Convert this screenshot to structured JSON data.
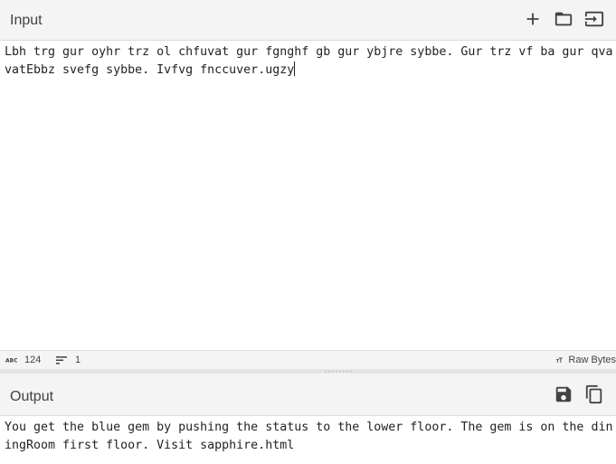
{
  "input": {
    "title": "Input",
    "text": "Lbh trg gur oyhr trz ol chfuvat gur fgnghf gb gur ybjre sybbe. Gur trz vf ba gur qvavatEbbz svefg sybbe. Ivfvg fnccuver.ugzy",
    "buttons": {
      "add_icon": "plus-icon",
      "open_icon": "folder-icon",
      "import_icon": "import-icon"
    }
  },
  "status": {
    "length": "124",
    "lines": "1",
    "encoding": "Raw Bytes"
  },
  "output": {
    "title": "Output",
    "text": "You get the blue gem by pushing the status to the lower floor. The gem is on the diningRoom first floor. Visit sapphire.html",
    "buttons": {
      "save_icon": "save-icon",
      "copy_icon": "copy-icon"
    }
  }
}
